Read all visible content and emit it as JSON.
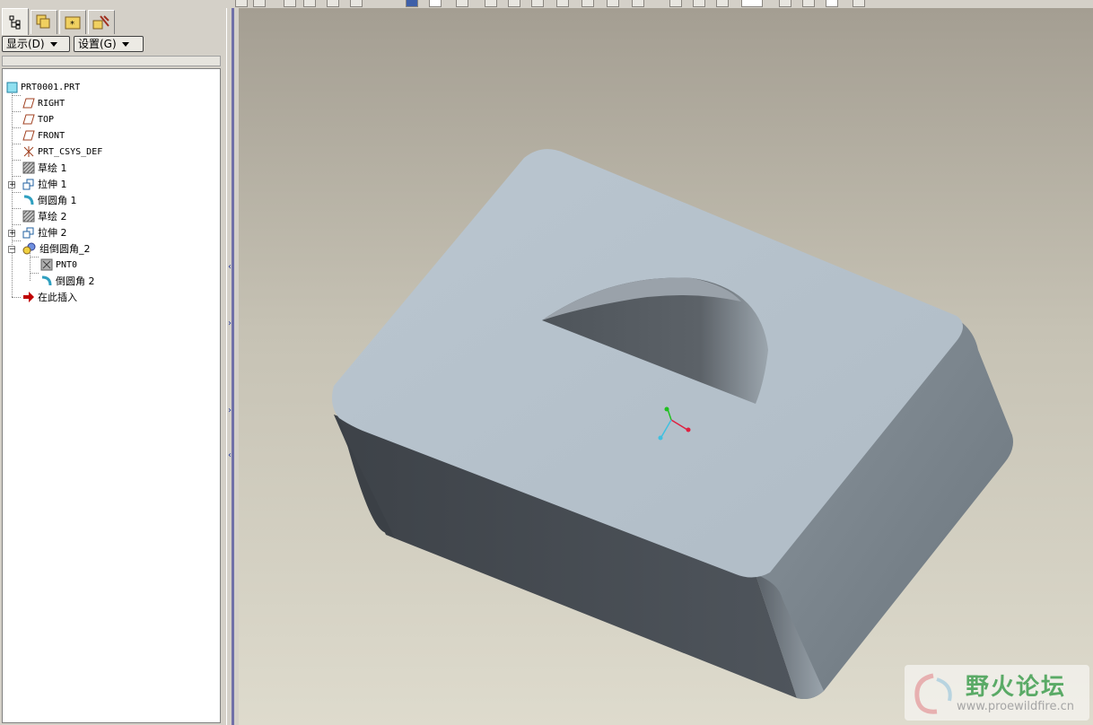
{
  "panel": {
    "display_menu": "显示(D)",
    "settings_menu": "设置(G)"
  },
  "tree": {
    "items": [
      {
        "label": "PRT0001.PRT",
        "icon": "part-icon"
      },
      {
        "label": "RIGHT",
        "icon": "datum-plane-icon"
      },
      {
        "label": "TOP",
        "icon": "datum-plane-icon"
      },
      {
        "label": "FRONT",
        "icon": "datum-plane-icon"
      },
      {
        "label": "PRT_CSYS_DEF",
        "icon": "csys-icon"
      },
      {
        "label": "草绘 1",
        "icon": "sketch-icon"
      },
      {
        "label": "拉伸 1",
        "icon": "extrude-icon",
        "expandable": true
      },
      {
        "label": "倒圆角 1",
        "icon": "round-icon"
      },
      {
        "label": "草绘 2",
        "icon": "sketch-icon"
      },
      {
        "label": "拉伸 2",
        "icon": "extrude-icon",
        "expandable": true
      },
      {
        "label": "组倒圆角_2",
        "icon": "group-icon",
        "expanded": true
      },
      {
        "label": "PNT0",
        "icon": "datum-point-icon"
      },
      {
        "label": "倒圆角 2",
        "icon": "round-icon"
      },
      {
        "label": "在此插入",
        "icon": "insert-here-arrow-icon"
      }
    ]
  },
  "watermark": {
    "title": "野火论坛",
    "url": "www.proewildfire.cn"
  },
  "colors": {
    "model_top": "#b6c2cc",
    "model_front": "#474c52",
    "model_side": "#7a858c",
    "insert_arrow": "#c00000"
  }
}
